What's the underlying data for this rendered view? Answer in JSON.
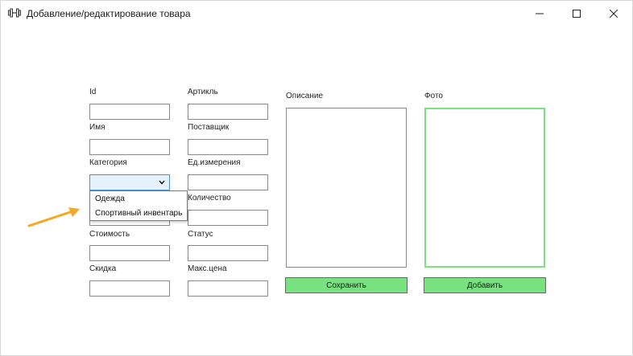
{
  "window": {
    "title": "Добавление/редактирование товара",
    "app_icon": "dumbbell-icon",
    "controls": [
      "minimize-icon",
      "maximize-icon",
      "close-icon"
    ]
  },
  "form": {
    "id_label": "Id",
    "article_label": "Артикль",
    "name_label": "Имя",
    "supplier_label": "Поставщик",
    "category_label": "Категория",
    "unit_label": "Ед.измерения",
    "quantity_label": "Количество",
    "cost_label": "Стоимость",
    "status_label": "Статус",
    "discount_label": "Скидка",
    "max_price_label": "Макс.цена",
    "description_label": "Описание",
    "photo_label": "Фото"
  },
  "category_dropdown": {
    "selected": "",
    "options": [
      "Одежда",
      "Спортивный инвентарь"
    ]
  },
  "buttons": {
    "save": "Сохранить",
    "add": "Добавить"
  },
  "colors": {
    "button_green": "#77e27f",
    "photo_border": "#77e27f",
    "annotation_arrow": "#f5a623",
    "combo_focus": "#4a90d9"
  }
}
